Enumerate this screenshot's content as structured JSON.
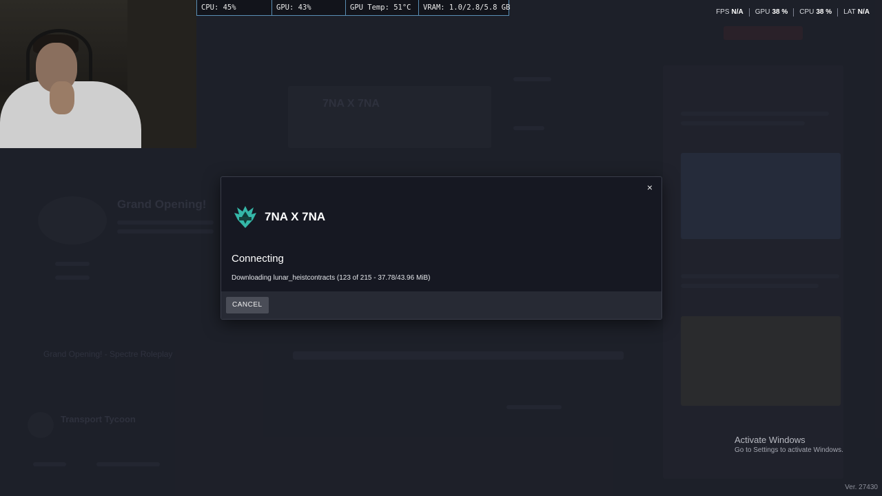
{
  "perf_overlay": {
    "cpu": "CPU: 45%",
    "gpu": "GPU: 43%",
    "gpu_temp": "GPU Temp: 51°C",
    "vram": "VRAM: 1.0/2.8/5.8 GB"
  },
  "stats": [
    {
      "label": "FPS",
      "value": "N/A"
    },
    {
      "label": "GPU",
      "value": "38 %"
    },
    {
      "label": "CPU",
      "value": "38 %"
    },
    {
      "label": "LAT",
      "value": "N/A"
    }
  ],
  "modal": {
    "close_icon": "×",
    "server_name": "7NA X 7NA",
    "status_title": "Connecting",
    "status_detail": "Downloading lunar_heistcontracts (123 of 215 - 37.78/43.96 MiB)",
    "cancel_label": "CANCEL"
  },
  "background": {
    "server_title": "7NA X 7NA",
    "featured_title": "Grand Opening!",
    "list_item": "Grand Opening! - Spectre Roleplay",
    "transport_title": "Transport Tycoon"
  },
  "windows_watermark": {
    "title": "Activate Windows",
    "subtitle": "Go to Settings to activate Windows."
  },
  "version": "Ver. 27430",
  "colors": {
    "accent_teal": "#39c9b7",
    "perf_border": "#5a8fb5",
    "modal_bg": "#161822",
    "footer_bg": "#272a34"
  }
}
